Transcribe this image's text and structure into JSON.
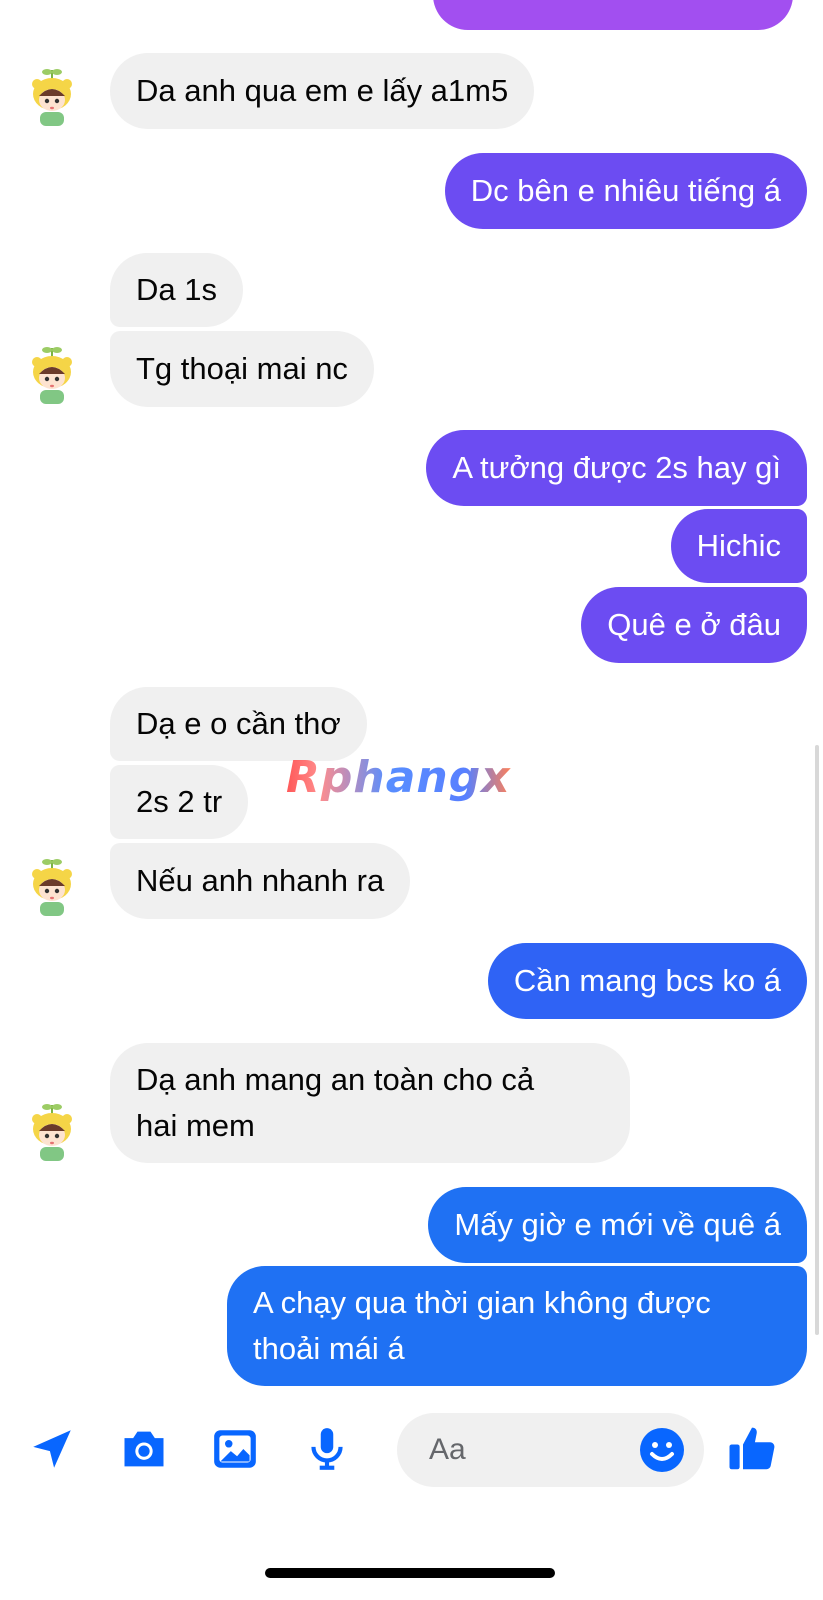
{
  "messages": [
    {
      "side": "received",
      "text": "Da anh qua em e lấy a1m5"
    },
    {
      "side": "sent",
      "text": "Dc bên e nhiêu tiếng á"
    },
    {
      "side": "received",
      "text": "Da 1s"
    },
    {
      "side": "received",
      "text": "Tg thoại mai nc"
    },
    {
      "side": "sent",
      "text": "A tưởng được 2s hay gì"
    },
    {
      "side": "sent",
      "text": "Hichic"
    },
    {
      "side": "sent",
      "text": "Quê e ở đâu"
    },
    {
      "side": "received",
      "text": "Dạ e o cần thơ"
    },
    {
      "side": "received",
      "text": "2s 2 tr"
    },
    {
      "side": "received",
      "text": "Nếu anh nhanh ra"
    },
    {
      "side": "sent",
      "text": "Cần mang bcs ko á"
    },
    {
      "side": "received",
      "text": "Dạ anh mang an toàn cho cả\nhai mem"
    },
    {
      "side": "sent",
      "text": "Mấy giờ e mới về quê á"
    },
    {
      "side": "sent",
      "text": "A chạy qua thời gian không được\nthoải mái á"
    }
  ],
  "watermark": "Rphangx",
  "composer": {
    "placeholder": "Aa",
    "icons": [
      "send-arrow-icon",
      "camera-icon",
      "image-icon",
      "microphone-icon",
      "emoji-icon",
      "thumbs-up-icon"
    ],
    "accent_color": "#0866ff"
  },
  "colors": {
    "received_bubble": "#f0f0f0",
    "sent_purple": "#8f3ef0",
    "sent_violet": "#6c4cf2",
    "sent_blue": "#2f63f5"
  }
}
